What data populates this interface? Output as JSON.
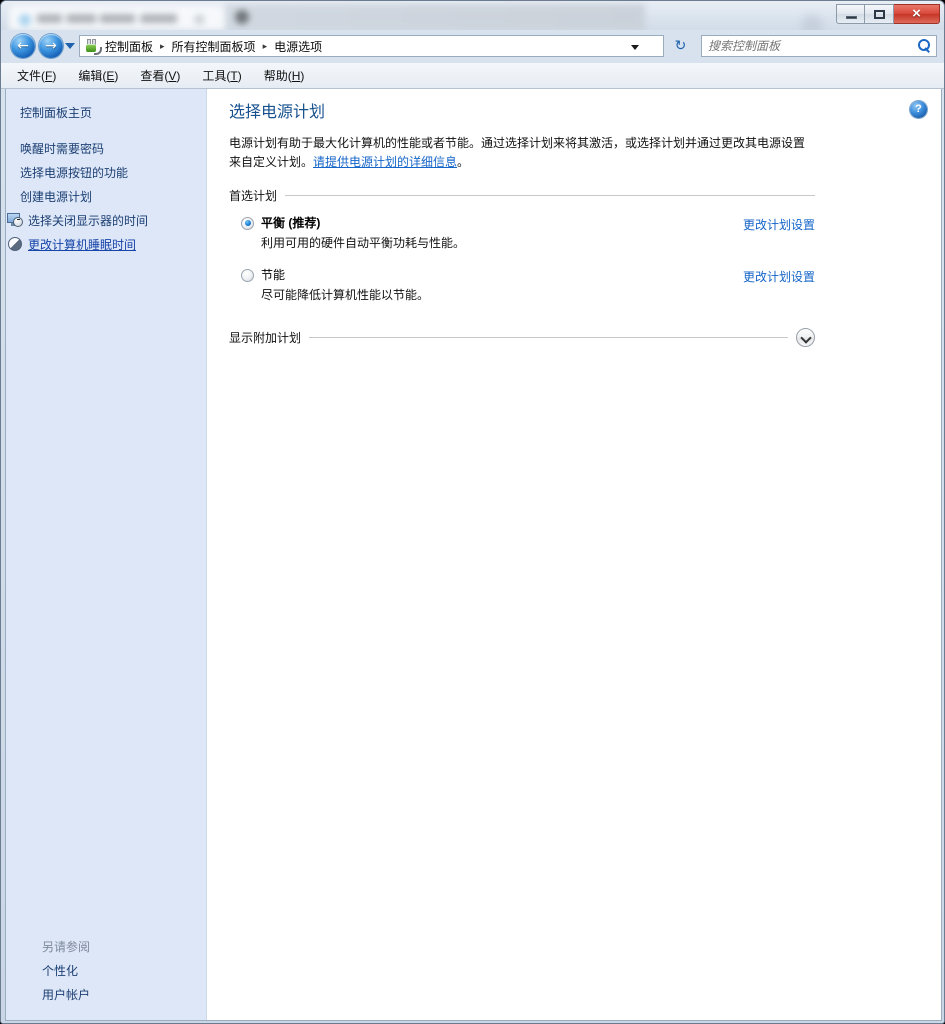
{
  "window": {
    "controls": {
      "minimize": "–",
      "maximize": "□",
      "close": "×"
    },
    "tab_placeholder_blurred": ""
  },
  "navigation": {
    "back_arrow": "←",
    "forward_arrow": "→",
    "address_icon": "power-plug-icon",
    "breadcrumbs": [
      {
        "label": "控制面板"
      },
      {
        "label": "所有控制面板项"
      },
      {
        "label": "电源选项"
      }
    ],
    "separator": "▸",
    "refresh_glyph": "↻"
  },
  "search": {
    "placeholder": "搜索控制面板",
    "value": ""
  },
  "menubar": {
    "items": [
      {
        "text": "文件(",
        "mnemonic": "F",
        "close": ")"
      },
      {
        "text": "编辑(",
        "mnemonic": "E",
        "close": ")"
      },
      {
        "text": "查看(",
        "mnemonic": "V",
        "close": ")"
      },
      {
        "text": "工具(",
        "mnemonic": "T",
        "close": ")"
      },
      {
        "text": "帮助(",
        "mnemonic": "H",
        "close": ")"
      }
    ]
  },
  "sidebar": {
    "home_label": "控制面板主页",
    "items": [
      {
        "label": "唤醒时需要密码",
        "icon": null
      },
      {
        "label": "选择电源按钮的功能",
        "icon": null
      },
      {
        "label": "创建电源计划",
        "icon": null
      },
      {
        "label": "选择关闭显示器的时间",
        "icon": "monitor-clock-icon"
      },
      {
        "label": "更改计算机睡眠时间",
        "icon": "moon-sleep-icon"
      }
    ],
    "bottom_heading": "另请参阅",
    "bottom_items": [
      {
        "label": "个性化"
      },
      {
        "label": "用户帐户"
      }
    ]
  },
  "main": {
    "help_glyph": "?",
    "title": "选择电源计划",
    "description_part1": "电源计划有助于最大化计算机的性能或者节能。通过选择计划来将其激活，或选择计划并通过更改其电源设置来自定义计划。",
    "description_link": "请提供电源计划的详细信息",
    "description_part2": "。",
    "section_label": "首选计划",
    "plans": [
      {
        "name": "平衡 (推荐)",
        "description": "利用可用的硬件自动平衡功耗与性能。",
        "selected": true,
        "link": "更改计划设置"
      },
      {
        "name": "节能",
        "description": "尽可能降低计算机性能以节能。",
        "selected": false,
        "link": "更改计划设置"
      }
    ],
    "expander_label": "显示附加计划"
  },
  "colors": {
    "sidebar_bg": "#dde7f7",
    "title_blue": "#17528f",
    "link_blue": "#1565c9",
    "sidebar_link": "#1c3f73",
    "close_red": "#d9493a"
  }
}
